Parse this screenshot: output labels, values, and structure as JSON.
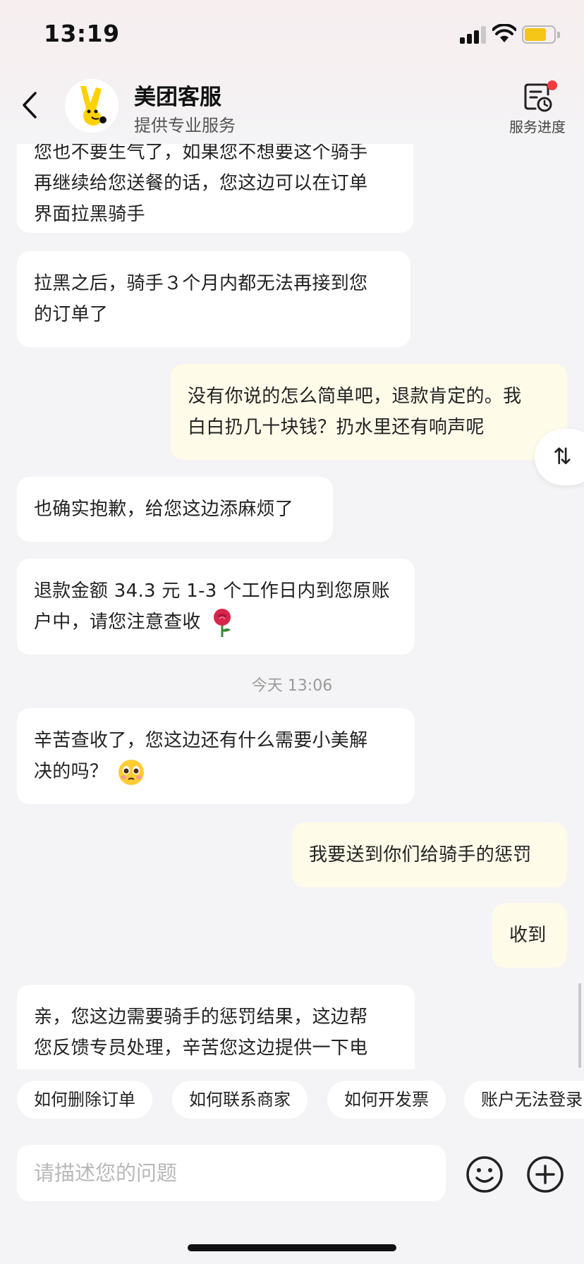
{
  "status_bar": {
    "time": "13:19",
    "battery_level": 0.75,
    "battery_color": "#f5c518"
  },
  "header": {
    "title": "美团客服",
    "subtitle": "提供专业服务",
    "progress_label": "服务进度",
    "notification_dot_color": "#f23c3c"
  },
  "messages": [
    {
      "side": "agent",
      "lines": [
        "您也不要生气了，如果您不想要这个骑手",
        "再继续给您送餐的话，您这边可以在订单",
        "界面拉黑骑手"
      ]
    },
    {
      "side": "agent",
      "lines": [
        "拉黑之后，骑手３个月内都无法再接到您",
        "的订单了"
      ]
    },
    {
      "side": "user",
      "lines": [
        "没有你说的怎么简单吧，退款肯定的。我",
        "白白扔几十块钱？扔水里还有响声呢"
      ]
    },
    {
      "side": "agent",
      "lines": [
        "也确实抱歉，给您这边添麻烦了"
      ]
    },
    {
      "side": "agent",
      "lines": [
        "退款金额 34.3 元 1-3 个工作日内到您原账",
        "户中，请您注意查收"
      ],
      "emoji": "rose"
    },
    {
      "timestamp": "今天 13:06"
    },
    {
      "side": "agent",
      "lines": [
        "辛苦查收了，您这边还有什么需要小美解",
        "决的吗？"
      ],
      "emoji": "pleading-face"
    },
    {
      "side": "user",
      "lines": [
        "我要送到你们给骑手的惩罚"
      ]
    },
    {
      "side": "user",
      "lines": [
        "收到"
      ]
    },
    {
      "side": "agent",
      "lines": [
        "亲，您这边需要骑手的惩罚结果，这边帮",
        "您反馈专员处理，辛苦您这边提供一下电"
      ]
    }
  ],
  "float_button_icon": "sort-arrows-icon",
  "quick_replies": [
    "如何删除订单",
    "如何联系商家",
    "如何开发票",
    "账户无法登录"
  ],
  "input": {
    "placeholder": "请描述您的问题",
    "value": ""
  },
  "colors": {
    "user_bubble": "#fffbe9",
    "agent_bubble": "#ffffff",
    "background": "#f4f4f6",
    "brand_yellow": "#ffd100"
  }
}
